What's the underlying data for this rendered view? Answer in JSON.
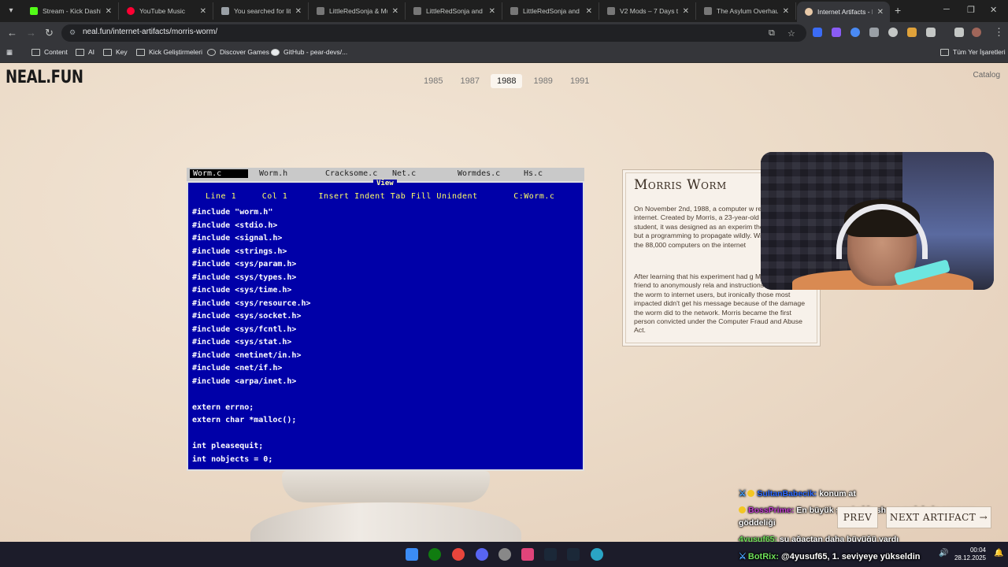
{
  "browser": {
    "tabs": [
      {
        "title": "Stream - Kick Dashbo",
        "color": "#53fc18"
      },
      {
        "title": "YouTube Music",
        "color": "#ff0033"
      },
      {
        "title": "You searched for littl",
        "color": "#9aa0a6"
      },
      {
        "title": "LittleRedSonja & Mu",
        "color": "#9aa0a6"
      },
      {
        "title": "LittleRedSonja and M",
        "color": "#9aa0a6"
      },
      {
        "title": "LittleRedSonja and M",
        "color": "#9aa0a6"
      },
      {
        "title": "V2 Mods – 7 Days to",
        "color": "#9aa0a6"
      },
      {
        "title": "The Asylum Overhaul",
        "color": "#9aa0a6"
      },
      {
        "title": "Internet Artifacts - N",
        "color": "#e8c9a8"
      }
    ],
    "url": "neal.fun/internet-artifacts/morris-worm/",
    "bookmarks": {
      "content": "Content",
      "ai": "AI",
      "key": "Key",
      "kick": "Kick Geliştirmeleri",
      "discover": "Discover Games",
      "github": "GitHub - pear-devs/...",
      "all": "Tüm Yer İşaretleri"
    }
  },
  "site": {
    "logo": "NEAL.FUN",
    "catalog": "Catalog",
    "years": [
      "1985",
      "1987",
      "1988",
      "1989",
      "1991"
    ],
    "active_year": "1988"
  },
  "editor": {
    "tabs": [
      "Worm.c",
      "Worm.h",
      "Cracksome.c",
      "Net.c",
      "Wormdes.c",
      "Hs.c"
    ],
    "view_label": "View",
    "status": "Line 1     Col 1      Insert Indent Tab Fill Unindent       C:Worm.c",
    "code": [
      "#include \"worm.h\"",
      "#include <stdio.h>",
      "#include <signal.h>",
      "#include <strings.h>",
      "#include <sys/param.h>",
      "#include <sys/types.h>",
      "#include <sys/time.h>",
      "#include <sys/resource.h>",
      "#include <sys/socket.h>",
      "#include <sys/fcntl.h>",
      "#include <sys/stat.h>",
      "#include <netinet/in.h>",
      "#include <net/if.h>",
      "#include <arpa/inet.h>",
      "",
      "extern errno;",
      "extern char *malloc();",
      "",
      "int pleasequit;",
      "int nobjects = 0;"
    ]
  },
  "artifact": {
    "title": "Morris Worm",
    "p1": "On November 2nd, 1988, a computer w released onto the internet. Created by Morris, a 23-year-old Cornell Universit student, it was designed as an experim the internet's size, but a programming to propagate wildly. Within 24 hours, c the 88,000 computers on the internet",
    "p2": "After learning that his experiment had g Morris asked a friend to anonymously rela and instructions for removing the worm to internet users, but ironically those most impacted didn't get his message because of the damage the worm did to the network. Morris became the first person convicted under the Computer Fraud and Abuse Act.",
    "prev": "PREV",
    "next": "NEXT ARTIFACT →"
  },
  "chat": [
    {
      "user": "SultanBabecik:",
      "msg": "konum at"
    },
    {
      "user": "BossPrime:",
      "msg": "En büyük şey Lolde shaco mainlerin anasının"
    },
    {
      "user": "",
      "msg": "göddeliği"
    },
    {
      "user": "4yusuf65:",
      "msg": "şu ağaçtan daha büyüğü vardı"
    },
    {
      "user": "BotRix:",
      "msg": "@4yusuf65, 1. seviyeye yükseldin"
    }
  ],
  "taskbar": {
    "time": "00:04",
    "date": "28.12.2025"
  }
}
